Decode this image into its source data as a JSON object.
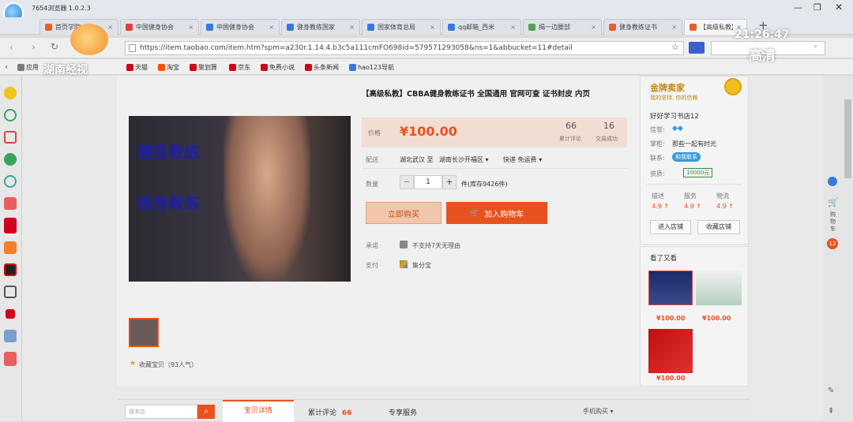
{
  "browser": {
    "title": "7654浏览器 1.0.2.3",
    "tabs": [
      {
        "label": "首页学院",
        "color": "#e85f2d"
      },
      {
        "label": "中国健身协会",
        "color": "#e04040"
      },
      {
        "label": "中国健身协会",
        "color": "#3a78d8"
      },
      {
        "label": "健身教练国家",
        "color": "#3a78d8"
      },
      {
        "label": "国家体育总局",
        "color": "#3a78d8"
      },
      {
        "label": "qq邮箱_西米",
        "color": "#3a78d8"
      },
      {
        "label": "揭一边腰部",
        "color": "#5aa050"
      },
      {
        "label": "健身教练证书",
        "color": "#e85f2d"
      },
      {
        "label": "【高级私教】",
        "color": "#e85f2d"
      }
    ],
    "url": "https://item.taobao.com/item.htm?spm=a230r.1.14.4.b3c5a111cmFO698id=579571293058&ns=1&abbucket=11#detail",
    "bookmarks": [
      {
        "label": "应用",
        "color": "#7a7a7a"
      },
      {
        "label": "天猫",
        "color": "#d0021b"
      },
      {
        "label": "淘宝",
        "color": "#ff5000"
      },
      {
        "label": "聚划算",
        "color": "#d0021b"
      },
      {
        "label": "京东",
        "color": "#d0021b"
      },
      {
        "label": "免费小说",
        "color": "#d0021b"
      },
      {
        "label": "头条新闻",
        "color": "#d0021b"
      },
      {
        "label": "hao123导航",
        "color": "#3a78d8"
      }
    ]
  },
  "overlay": {
    "channel": "湖南经视",
    "clock": "21:26:47",
    "quality": "高清"
  },
  "product": {
    "image_text_1": "健身教练",
    "image_text_2": "健身教练",
    "title": "【高级私教】CBBA健身教练证书 全国通用 官网可查 证书封皮 内页",
    "price_label": "价格",
    "price": "¥100.00",
    "reviews_count": "66",
    "reviews_label": "累计评论",
    "sales_count": "16",
    "sales_label": "交易成功",
    "ship_label": "配送",
    "ship_from": "湖北武汉 至",
    "ship_to": "湖南长沙开福区 ▾",
    "ship_fee": "快递 免运费 ▾",
    "qty_label": "数量",
    "qty": "1",
    "stock": "件(库存9426件)",
    "buy_now": "立即购买",
    "add_cart": "加入购物车",
    "promise_label": "承诺",
    "promise": "不支持7天无理由",
    "pay_label": "支付",
    "pay": "集分宝",
    "favorite": "收藏宝贝（93人气）"
  },
  "shop": {
    "badge": "金牌卖家",
    "badge_sub": "我的坚持, 你的信赖",
    "name": "好好学习书店12",
    "credit_label": "信誉:",
    "keeper_label": "掌柜:",
    "keeper": "那些一起有时光",
    "contact_label": "联系:",
    "contact": "和我联系",
    "qual_label": "资质:",
    "qual": "10000元",
    "rate_labels": [
      "描述",
      "服务",
      "物流"
    ],
    "rate_values": [
      "4.9 ↑",
      "4.9 ↑",
      "4.9 ↑"
    ],
    "enter_shop": "进入店铺",
    "fav_shop": "收藏店铺"
  },
  "also": {
    "title": "看了又看",
    "items": [
      "¥100.00",
      "¥100.00",
      "¥100.00"
    ]
  },
  "bottom": {
    "search_placeholder": "搜本店",
    "tab_detail": "宝贝详情",
    "tab_reviews": "累计评论",
    "tab_reviews_count": "66",
    "tab_service": "专享服务",
    "tab_mobile": "手机购买 ▾"
  },
  "rside": {
    "cart": "购物车",
    "cart_count": "12"
  }
}
